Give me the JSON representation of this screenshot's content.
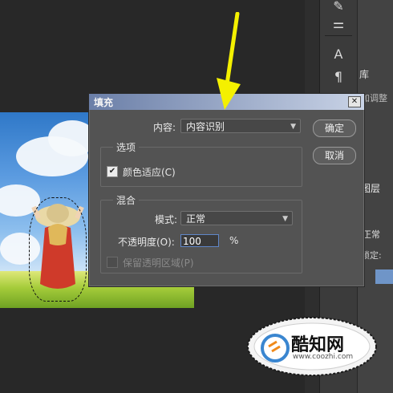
{
  "colors": {
    "accent": "#5f86c7",
    "arrow": "#f4f000",
    "dialog_bg": "#535353"
  },
  "tools": {
    "icons": [
      "brush-icon",
      "adjust-icon",
      "text-icon",
      "paragraph-icon"
    ],
    "text_tool": "A",
    "paragraph": "¶"
  },
  "panels": {
    "library_tab": "库",
    "adjust_text": "加调整",
    "layers_tab": "图层",
    "blend": "正常",
    "lock": "锁定:"
  },
  "dialog": {
    "title": "填充",
    "close": "✕",
    "contents_label": "内容:",
    "contents_value": "内容识别",
    "ok": "确定",
    "cancel": "取消",
    "options_group": "选项",
    "color_adapt": "颜色适应(C)",
    "color_adapt_checked": true,
    "blend_group": "混合",
    "mode_label": "模式:",
    "mode_value": "正常",
    "opacity_label": "不透明度(O):",
    "opacity_value": "100",
    "opacity_unit": "%",
    "preserve_transparency": "保留透明区域(P)",
    "preserve_checked": false
  },
  "watermark": {
    "brand": "酷知网",
    "url": "www.coozhi.com"
  }
}
